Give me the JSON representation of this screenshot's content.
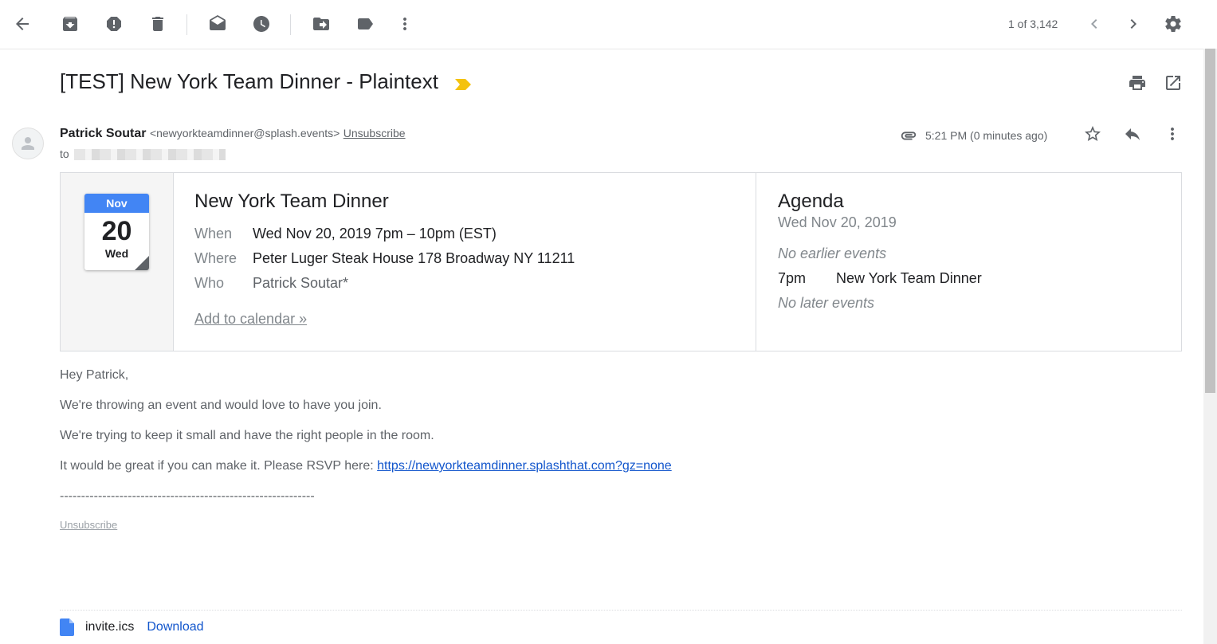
{
  "toolbar": {
    "icons": [
      "back-arrow-icon",
      "archive-icon",
      "report-spam-icon",
      "delete-icon",
      "mark-unread-icon",
      "snooze-icon",
      "move-to-icon",
      "label-icon",
      "more-vert-icon"
    ],
    "pager": "1 of 3,142"
  },
  "email": {
    "subject": "[TEST] New York Team Dinner - Plaintext",
    "sender_name": "Patrick Soutar",
    "sender_email": "<newyorkteamdinner@splash.events>",
    "unsubscribe": "Unsubscribe",
    "to_label": "to",
    "timestamp": "5:21 PM (0 minutes ago)"
  },
  "invite": {
    "cal_month": "Nov",
    "cal_day": "20",
    "cal_dow": "Wed",
    "title": "New York Team Dinner",
    "when_label": "When",
    "when_value": "Wed Nov 20, 2019 7pm – 10pm (EST)",
    "where_label": "Where",
    "where_value": "Peter Luger Steak House 178 Broadway NY 11211",
    "who_label": "Who",
    "who_value": "Patrick Soutar*",
    "add_calendar": "Add to calendar »"
  },
  "agenda": {
    "title": "Agenda",
    "date": "Wed Nov 20, 2019",
    "no_earlier": "No earlier events",
    "event_time": "7pm",
    "event_name": "New York Team Dinner",
    "no_later": "No later events"
  },
  "body": {
    "greeting": "Hey Patrick,",
    "line1": "We're throwing an event and would love to have you join.",
    "line2": "We're trying to keep it small and have the right people in the room.",
    "line3": "It would be great if you can make it. Please RSVP here: ",
    "rsvp_link": "https://newyorkteamdinner.splashthat.com?gz=none",
    "separator": "------------------------------------------------------------",
    "unsubscribe": "Unsubscribe"
  },
  "attachment": {
    "filename": "invite.ics",
    "download": "Download"
  },
  "colors": {
    "accent_blue": "#4285f4",
    "link_blue": "#1155cc",
    "important_tag": "#f4c20d"
  }
}
